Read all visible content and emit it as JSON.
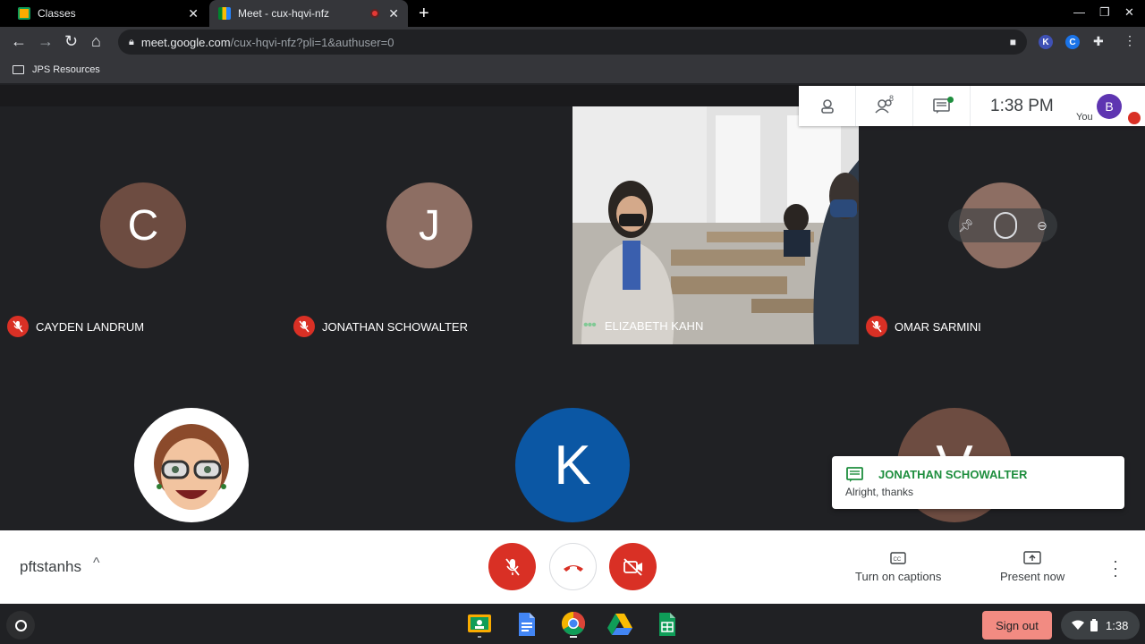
{
  "browser": {
    "tabs": [
      {
        "title": "Classes",
        "icon": "google-classroom-icon"
      },
      {
        "title": "Meet - cux-hqvi-nfz",
        "icon": "google-meet-icon",
        "recording": true
      }
    ],
    "url_host": "meet.google.com",
    "url_path": "/cux-hqvi-nfz?pli=1&authuser=0",
    "extensions": [
      "K",
      "C"
    ],
    "bookmark": "JPS Resources"
  },
  "meeting": {
    "participants": [
      {
        "name": "CAYDEN LANDRUM",
        "initial": "C",
        "color": "#6d4c41",
        "muted": true
      },
      {
        "name": "JONATHAN SCHOWALTER",
        "initial": "J",
        "color": "#8d6e63",
        "muted": true
      },
      {
        "name": "ELIZABETH KAHN",
        "video": true,
        "speaking": true
      },
      {
        "name": "OMAR SARMINI",
        "color": "#8d6e63",
        "muted": true
      },
      {
        "name": "",
        "avatar_type": "bitmoji"
      },
      {
        "initial": "K",
        "color": "#0b57a4"
      },
      {
        "initial": "V",
        "color": "#6d4c41"
      }
    ],
    "participant_count": "8",
    "time": "1:38 PM",
    "you_label": "You",
    "user_initial": "B",
    "meeting_code": "pftstanhs"
  },
  "chat_toast": {
    "sender": "JONATHAN SCHOWALTER",
    "message": "Alright, thanks"
  },
  "controls": {
    "captions_label": "Turn on captions",
    "present_label": "Present now"
  },
  "shelf": {
    "apps": [
      "google-classroom-icon",
      "google-docs-icon",
      "chrome-icon",
      "google-drive-icon",
      "google-sheets-icon"
    ],
    "sign_out": "Sign out",
    "clock": "1:38"
  }
}
